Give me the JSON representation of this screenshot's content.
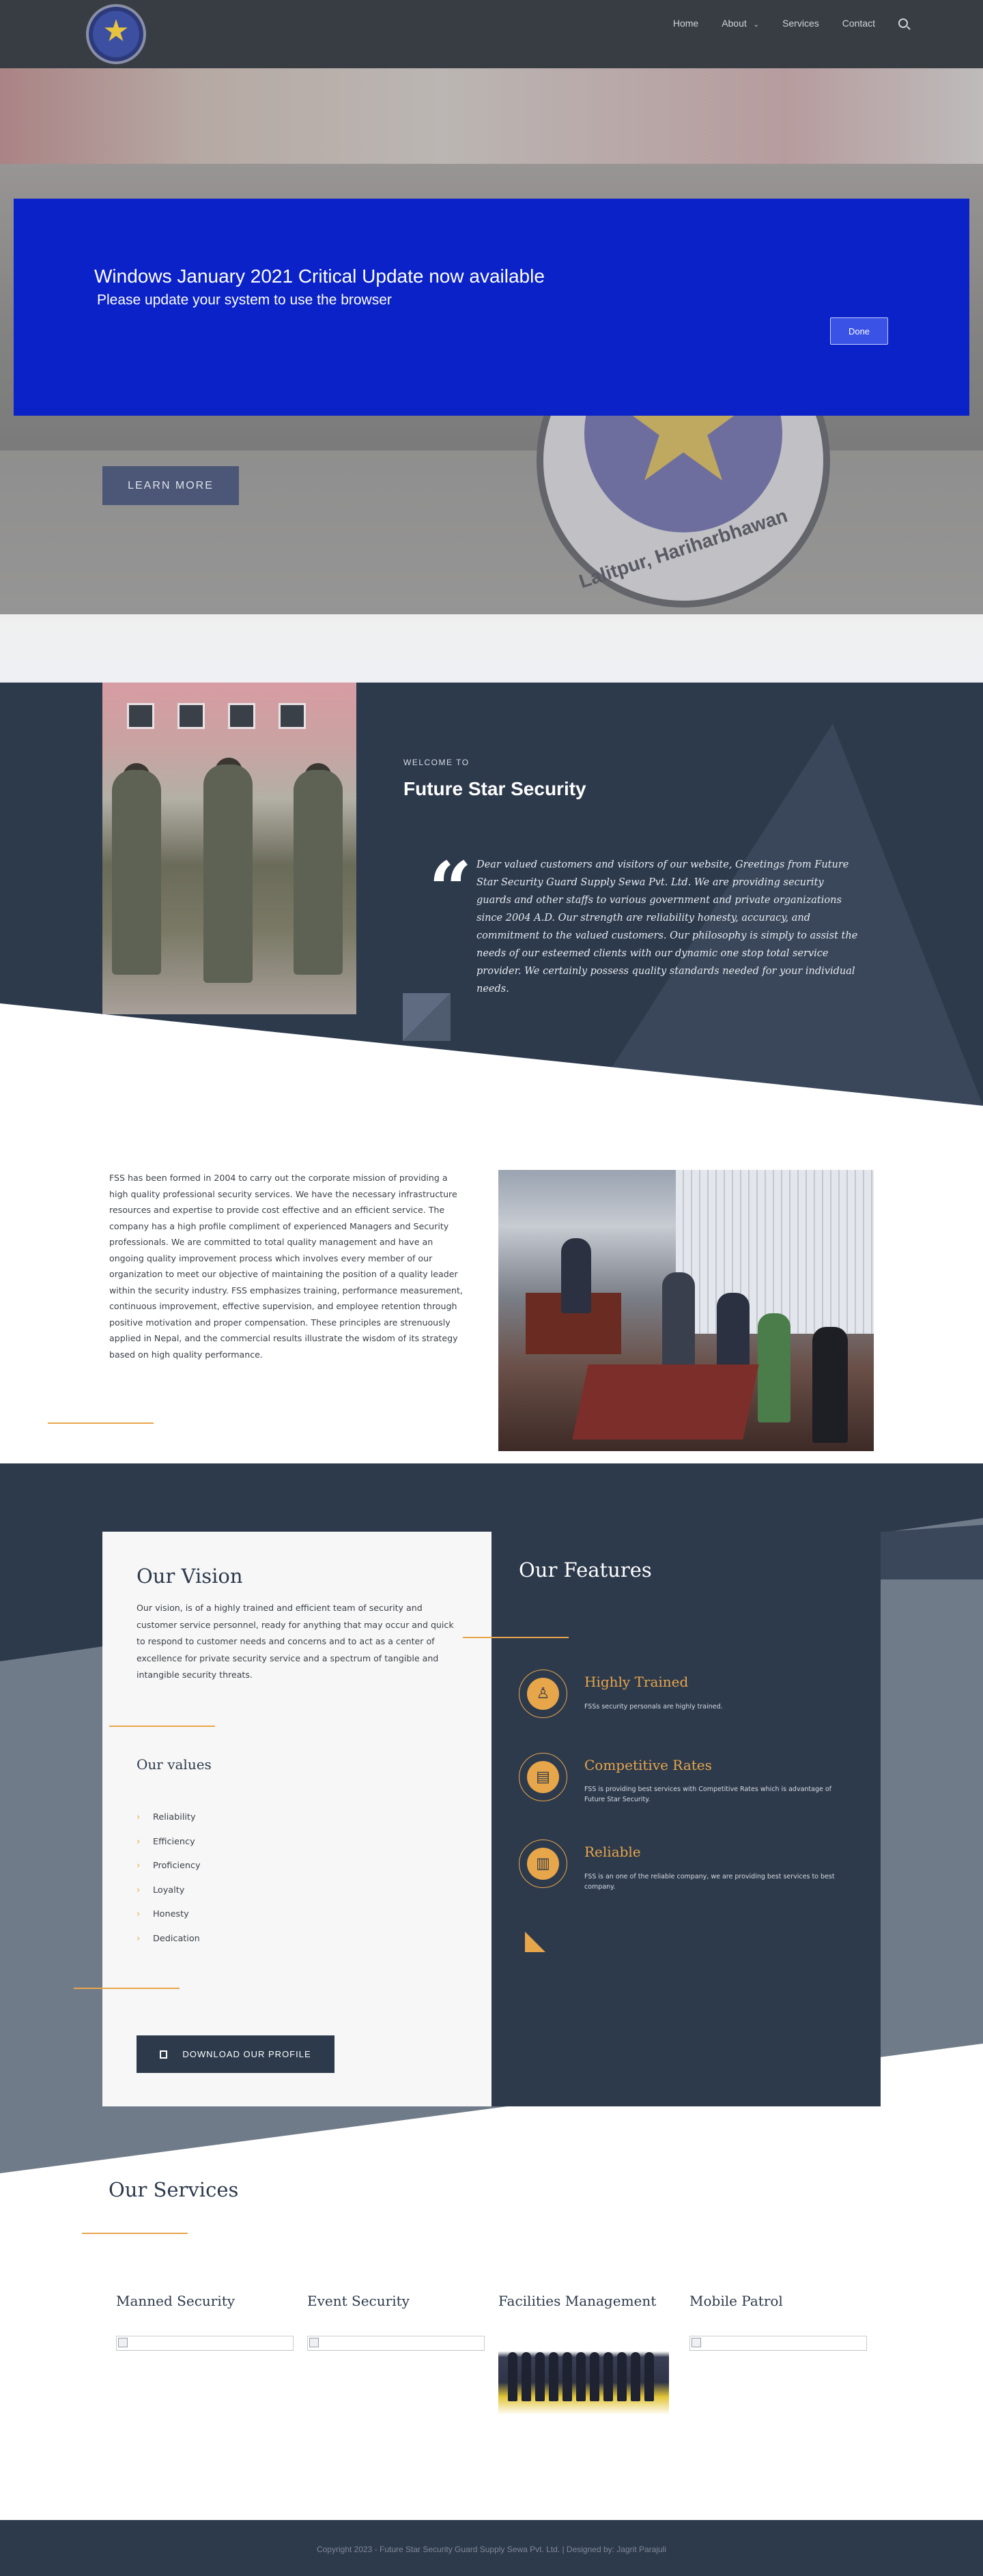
{
  "header": {
    "nav": [
      "Home",
      "About",
      "Services",
      "Contact"
    ]
  },
  "hero": {
    "seal_text": "Lalitpur, Hariharbhawan",
    "learn_more": "LEARN MORE"
  },
  "modal": {
    "title": "Windows January 2021 Critical Update now available",
    "subtitle": "Please update your system to use the browser",
    "done": "Done"
  },
  "welcome": {
    "kicker": "WELCOME TO",
    "title": "Future Star Security",
    "quote": "Dear valued customers and visitors of our website, Greetings from Future Star Security Guard Supply Sewa Pvt. Ltd. We are providing security guards and other staffs to various government and private organizations since 2004 A.D. Our strength are reliability honesty, accuracy, and commitment to the valued customers. Our philosophy is simply to assist the needs of our esteemed clients with our dynamic one stop total service provider. We certainly possess quality standards needed for your individual needs."
  },
  "about": {
    "text": "FSS has been formed in 2004 to carry out the corporate mission of providing a high quality professional security services. We have the necessary infrastructure resources and expertise to provide cost effective and an efficient service. The company has a high profile compliment of experienced Managers and Security professionals. We are committed to total quality management and have an ongoing quality improvement process which involves every member of our organization to meet our objective of maintaining the position of a quality leader within the security industry. FSS emphasizes training, performance measurement, continuous improvement, effective supervision, and employee retention through positive motivation and proper compensation. These principles are strenuously applied in Nepal, and the commercial results illustrate the wisdom of its strategy based on high quality performance."
  },
  "vision": {
    "title": "Our Vision",
    "text": "Our vision, is of a highly trained and efficient team of security and customer service personnel, ready for anything that may occur and quick to respond to customer needs and concerns and to act as a center of excellence for private security service and a spectrum of tangible and intangible security threats.",
    "values_title": "Our values",
    "values": [
      "Reliability",
      "Efficiency",
      "Proficiency",
      "Loyalty",
      "Honesty",
      "Dedication"
    ],
    "button": "DOWNLOAD OUR PROFILE"
  },
  "features": {
    "title": "Our Features",
    "items": [
      {
        "title": "Highly Trained",
        "text": "FSSs security personals are highly trained.",
        "icon": "person-icon"
      },
      {
        "title": "Competitive Rates",
        "text": "FSS is providing best services with Competitive Rates which is advantage of Future Star Security.",
        "icon": "book-icon"
      },
      {
        "title": "Reliable",
        "text": "FSS is an one of the reliable company, we are providing best services to best company.",
        "icon": "bar-chart-icon"
      }
    ]
  },
  "services": {
    "title": "Our Services",
    "items": [
      "Manned Security",
      "Event Security",
      "Facilities Management",
      "Mobile Patrol"
    ]
  },
  "footer": {
    "text": "Copyright 2023 - Future Star Security Guard Supply Sewa Pvt. Ltd. | Designed by: Jagrit Parajuli"
  },
  "colors": {
    "navy": "#2d3a4c",
    "accent": "#e8a64a",
    "modal_blue": "#0a22c7"
  }
}
